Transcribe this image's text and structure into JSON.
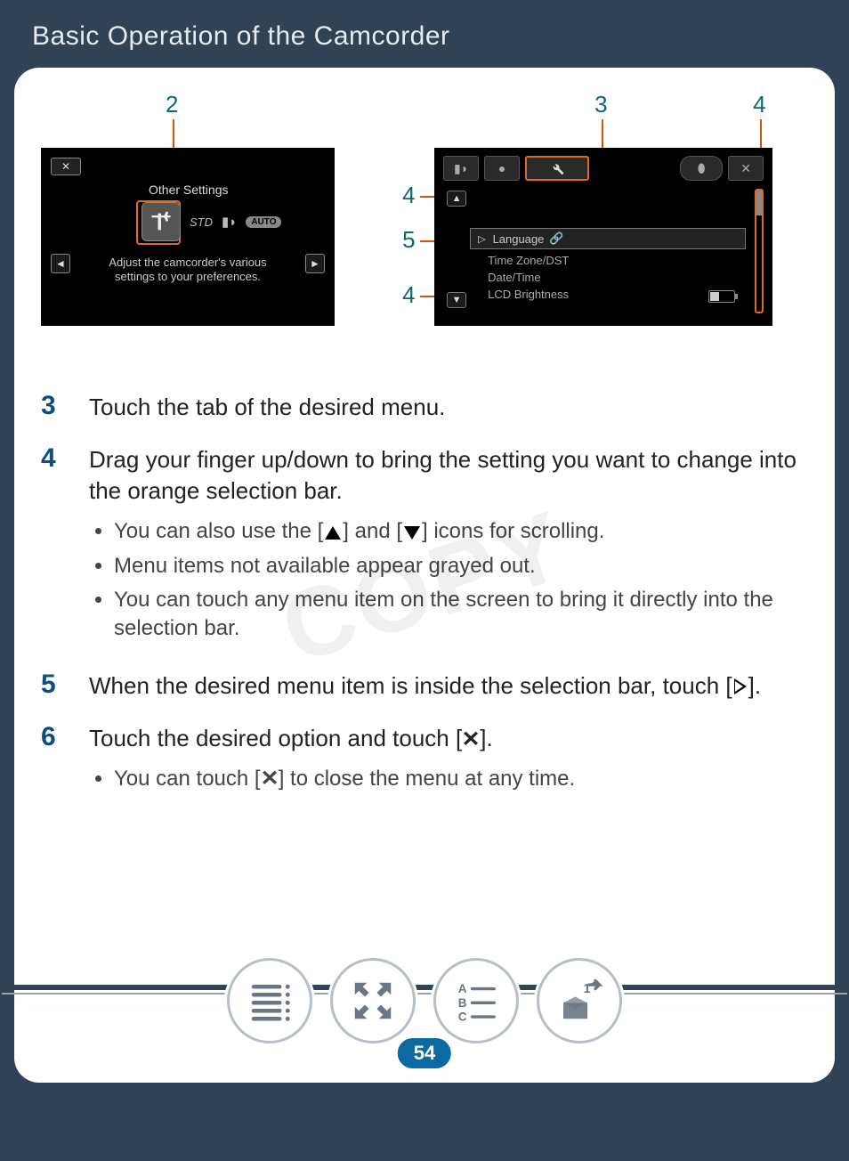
{
  "header": {
    "title": "Basic Operation of the Camcorder"
  },
  "watermark": "COPY",
  "page_number": "54",
  "figure_left": {
    "callout_top": "2",
    "screen_title": "Other Settings",
    "mode_std": "STD",
    "mode_auto": "AUTO",
    "description": "Adjust the camcorder's various settings to your preferences."
  },
  "figure_right": {
    "callout_tab": "3",
    "callout_scrollbar": "4",
    "callout_arrow_up": "4",
    "callout_arrow_dn": "4",
    "callout_selection": "5",
    "selected_item": "Language",
    "list_items": [
      "Time Zone/DST",
      "Date/Time",
      "LCD Brightness"
    ]
  },
  "steps": {
    "s3": {
      "num": "3",
      "text": "Touch the tab of the desired menu."
    },
    "s4": {
      "num": "4",
      "text": "Drag your finger up/down to bring the setting you want to change into the orange selection bar.",
      "bullets": {
        "b1_a": "You can also use the [",
        "b1_b": "] and [",
        "b1_c": "] icons for scrolling.",
        "b2": "Menu items not available appear grayed out.",
        "b3": "You can touch any menu item on the screen to bring it directly into the selection bar."
      }
    },
    "s5": {
      "num": "5",
      "text_a": "When the desired menu item is inside the selection bar, touch [",
      "text_b": "]."
    },
    "s6": {
      "num": "6",
      "text_a": "Touch the desired option and touch [",
      "text_b": "].",
      "bullet_a": "You can touch [",
      "bullet_b": "] to close the menu at any time."
    }
  },
  "nav": {
    "btn1": "toc",
    "btn2": "fullscreen",
    "btn3": "index",
    "btn4": "back"
  }
}
